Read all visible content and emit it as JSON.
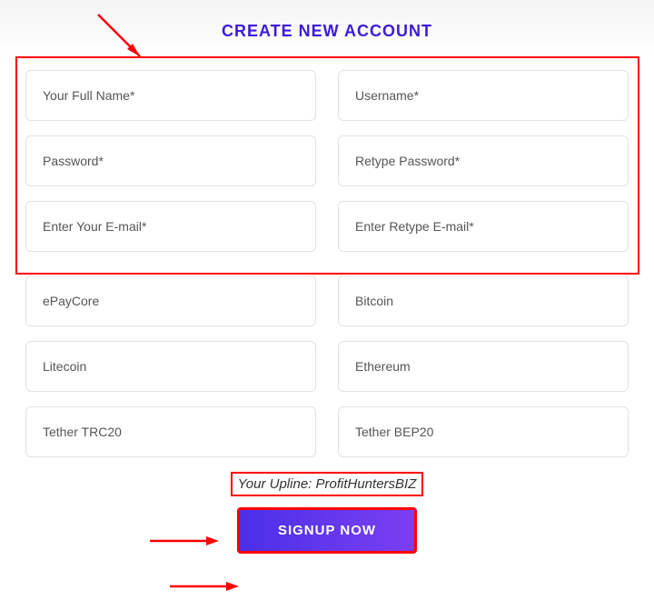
{
  "title": "CREATE NEW ACCOUNT",
  "fields": {
    "fullname": "Your Full Name*",
    "username": "Username*",
    "password": "Password*",
    "retype_password": "Retype Password*",
    "email": "Enter Your E-mail*",
    "retype_email": "Enter Retype E-mail*",
    "epaycore": "ePayCore",
    "bitcoin": "Bitcoin",
    "litecoin": "Litecoin",
    "ethereum": "Ethereum",
    "tether_trc": "Tether TRC20",
    "tether_bep": "Tether BEP20"
  },
  "upline": "Your Upline: ProfitHuntersBIZ",
  "signup": "SIGNUP NOW",
  "colors": {
    "title": "#3d1ad9",
    "annotation": "#ff0000",
    "button_start": "#4a2fe8",
    "button_end": "#7b3ff2"
  }
}
